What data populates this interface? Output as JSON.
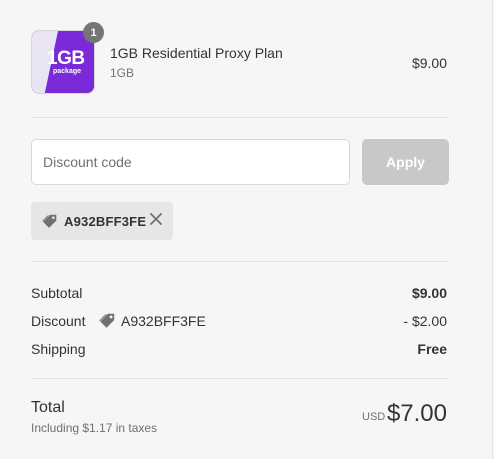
{
  "product": {
    "image_text_big": "1GB",
    "image_text_small": "package",
    "quantity": "1",
    "name": "1GB Residential Proxy Plan",
    "variant": "1GB",
    "price": "$9.00"
  },
  "discount_form": {
    "placeholder": "Discount code",
    "apply_label": "Apply"
  },
  "applied_code": "A932BFF3FE",
  "summary": {
    "subtotal_label": "Subtotal",
    "subtotal_value": "$9.00",
    "discount_label": "Discount",
    "discount_code": "A932BFF3FE",
    "discount_value": "- $2.00",
    "shipping_label": "Shipping",
    "shipping_value": "Free",
    "total_label": "Total",
    "tax_note": "Including $1.17 in taxes",
    "currency": "USD",
    "total_value": "$7.00"
  },
  "colors": {
    "apply_button_disabled": "#c8c8c8",
    "badge": "#757575",
    "product_image": "#7a2ad8"
  }
}
